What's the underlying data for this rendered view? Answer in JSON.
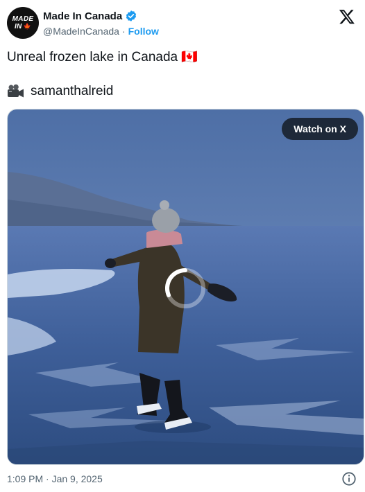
{
  "author": {
    "display_name": "Made In Canada",
    "handle": "@MadeInCanada",
    "separator": "·",
    "follow_label": "Follow",
    "avatar_line1": "MADE",
    "avatar_line2": "IN",
    "avatar_leaf": "🍁",
    "verified_icon": "verified-badge-icon",
    "accent_color": "#1d9bf0"
  },
  "tweet": {
    "text": "Unreal frozen lake in Canada 🇨🇦",
    "credit_icon": "video-camera-icon",
    "credit_text": "samanthalreid"
  },
  "media": {
    "watch_label": "Watch on X",
    "loading": true
  },
  "footer": {
    "timestamp": "1:09 PM · Jan 9, 2025",
    "info_icon": "info-icon"
  }
}
